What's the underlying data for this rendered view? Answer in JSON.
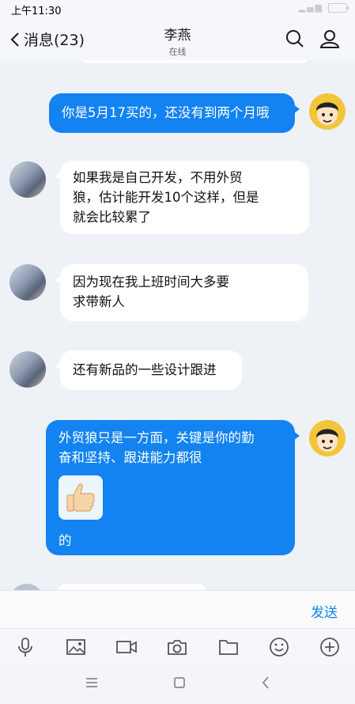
{
  "status_bar": {
    "time": "上午11:30"
  },
  "header": {
    "back_label": "消息(23)",
    "contact_name": "李燕",
    "contact_status": "在线"
  },
  "messages": [
    {
      "side": "out",
      "text": "你是5月17买的，还没有到两个月哦"
    },
    {
      "side": "in",
      "lines": [
        "如果我是自己开发，不用外贸",
        "狼，估计能开发10个这样，但是",
        "就会比较累了"
      ]
    },
    {
      "side": "in",
      "lines": [
        "因为现在我上班时间大多要",
        "求带新人"
      ]
    },
    {
      "side": "in",
      "text": "还有新品的一些设计跟进"
    },
    {
      "side": "out",
      "lines": [
        "外贸狼只是一方面，关键是你的勤",
        "奋和坚持、跟进能力都很"
      ],
      "sticker": "thumbs-up",
      "tail": "的"
    }
  ],
  "input": {
    "send_label": "发送"
  },
  "toolbar_icons": [
    "microphone-icon",
    "image-icon",
    "video-icon",
    "camera-icon",
    "folder-icon",
    "emoji-icon",
    "plus-icon"
  ],
  "colors": {
    "accent": "#1283f0",
    "background": "#eef1f6"
  }
}
